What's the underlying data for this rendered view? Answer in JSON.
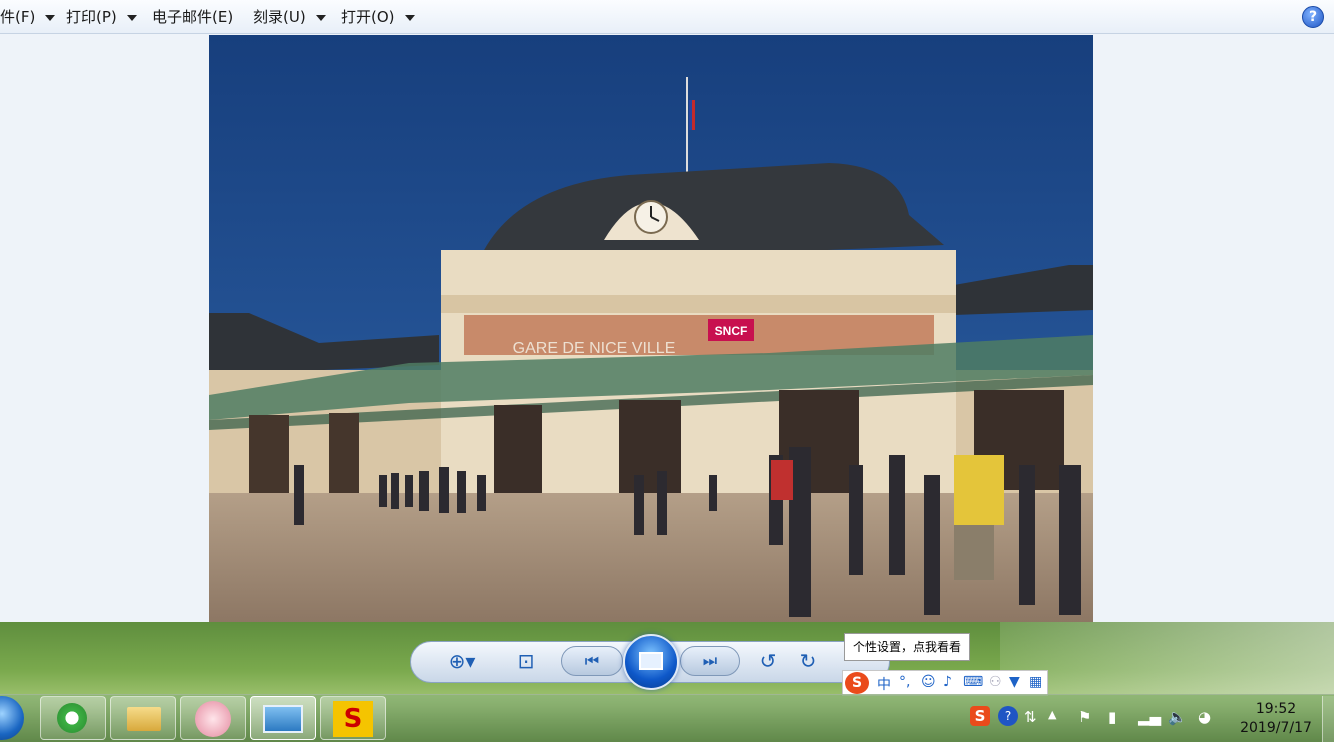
{
  "menubar": {
    "items": [
      {
        "label": "件(F)"
      },
      {
        "label": "打印(P)"
      },
      {
        "label": "电子邮件(E)"
      },
      {
        "label": "刻录(U)"
      },
      {
        "label": "打开(O)"
      }
    ],
    "help_label": "?"
  },
  "photo": {
    "sign_text": "SNCF",
    "facade_text": "GARE DE NICE VILLE"
  },
  "controls": {
    "tooltip": "个性设置，点我看看"
  },
  "ime": {
    "lang": "中",
    "punct": "°,"
  },
  "clock": {
    "time": "19:52",
    "date": "2019/7/17"
  },
  "colors": {
    "sky": "#1d4a8c",
    "accent": "#1f5fb4",
    "sign": "#c8104f"
  }
}
